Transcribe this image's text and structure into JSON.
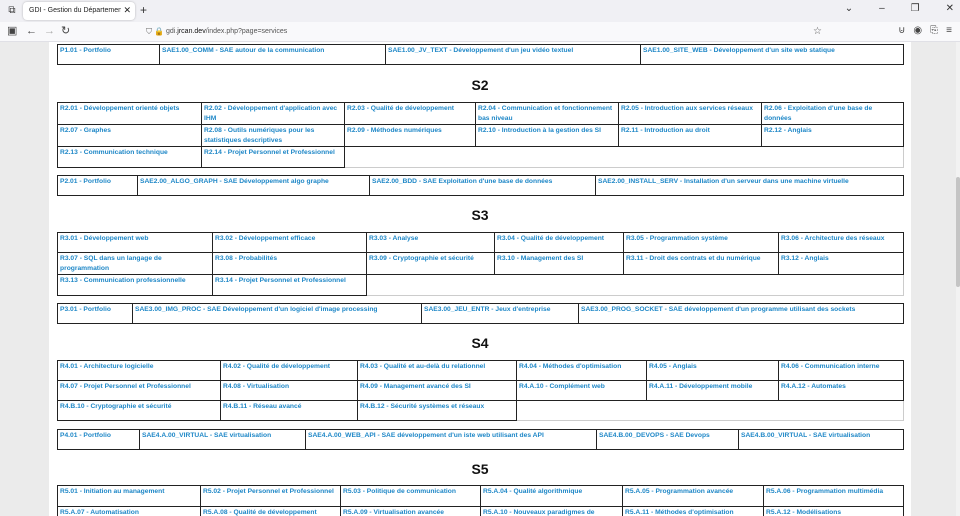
{
  "browser": {
    "tab_title": "GDI - Gestion du Département Info",
    "url_prefix": "gdi.",
    "url_host": "jrcan.dev",
    "url_path": "/index.php?page=services"
  },
  "s1_projects": [
    "P1.01 - Portfolio",
    "SAE1.00_COMM - SAE autour de la communication",
    "SAE1.00_JV_TEXT - Développement d'un jeu vidéo textuel",
    "SAE1.00_SITE_WEB - Développement d'un site web statique"
  ],
  "s2": {
    "title": "S2",
    "rows": [
      [
        "R2.01 - Développement orienté objets",
        "R2.02 - Développement d'application avec IHM",
        "R2.03 - Qualité de développement",
        "R2.04 - Communication et fonctionnement bas niveau",
        "R2.05 - Introduction aux services réseaux",
        "R2.06 - Exploitation d'une base de données"
      ],
      [
        "R2.07 - Graphes",
        "R2.08 - Outils numériques pour les statistiques descriptives",
        "R2.09 - Méthodes numériques",
        "R2.10 - Introduction à la gestion des SI",
        "R2.11 - Introduction au droit",
        "R2.12 - Anglais"
      ],
      [
        "R2.13 - Communication technique",
        "R2.14 - Projet Personnel et Professionnel"
      ]
    ],
    "projects": [
      "P2.01 - Portfolio",
      "SAE2.00_ALGO_GRAPH - SAE Développement algo graphe",
      "SAE2.00_BDD - SAE Exploitation d'une base de données",
      "SAE2.00_INSTALL_SERV - Installation d'un serveur dans une machine virtuelle"
    ]
  },
  "s3": {
    "title": "S3",
    "rows": [
      [
        "R3.01 - Développement web",
        "R3.02 - Développement efficace",
        "R3.03 - Analyse",
        "R3.04 - Qualité de développement",
        "R3.05 - Programmation système",
        "R3.06 - Architecture des réseaux"
      ],
      [
        "R3.07 - SQL dans un langage de programmation",
        "R3.08 - Probabilités",
        "R3.09 - Cryptographie et sécurité",
        "R3.10 - Management des SI",
        "R3.11 - Droit des contrats et du numérique",
        "R3.12 - Anglais"
      ],
      [
        "R3.13 - Communication professionnelle",
        "R3.14 - Projet Personnel et Professionnel"
      ]
    ],
    "projects": [
      "P3.01 - Portfolio",
      "SAE3.00_IMG_PROC - SAE Développement d'un logiciel d'image processing",
      "SAE3.00_JEU_ENTR - Jeux d'entreprise",
      "SAE3.00_PROG_SOCKET - SAE développement d'un programme utilisant des sockets"
    ]
  },
  "s4": {
    "title": "S4",
    "rows": [
      [
        "R4.01 - Architecture logicielle",
        "R4.02 - Qualité de développement",
        "R4.03 - Qualité et au-delà du relationnel",
        "R4.04 - Méthodes d'optimisation",
        "R4.05 - Anglais",
        "R4.06 - Communication interne"
      ],
      [
        "R4.07 - Projet Personnel et Professionnel",
        "R4.08 - Virtualisation",
        "R4.09 - Management avancé des SI",
        "R4.A.10 - Complément web",
        "R4.A.11 - Développement mobile",
        "R4.A.12 - Automates"
      ],
      [
        "R4.B.10 - Cryptographie et sécurité",
        "R4.B.11 - Réseau avancé",
        "R4.B.12 - Sécurité systèmes et réseaux"
      ]
    ],
    "projects": [
      "P4.01 - Portfolio",
      "SAE4.A.00_VIRTUAL - SAE virtualisation",
      "SAE4.A.00_WEB_API - SAE développement d'un iste web utilisant des API",
      "SAE4.B.00_DEVOPS - SAE Devops",
      "SAE4.B.00_VIRTUAL - SAE virtualisation"
    ]
  },
  "s5": {
    "title": "S5",
    "rows": [
      [
        "R5.01 - Initiation au management",
        "R5.02 - Projet Personnel et Professionnel",
        "R5.03 - Politique de communication",
        "R5.A.04 - Qualité algorithmique",
        "R5.A.05 - Programmation avancée",
        "R5.A.06 - Programmation multimédia"
      ],
      [
        "R5.A.07 - Automatisation",
        "R5.A.08 - Qualité de développement",
        "R5.A.09 - Virtualisation avancée",
        "R5.A.10 - Nouveaux paradigmes de",
        "R5.A.11 - Méthodes d'optimisation",
        "R5.A.12 - Modélisations"
      ]
    ]
  }
}
